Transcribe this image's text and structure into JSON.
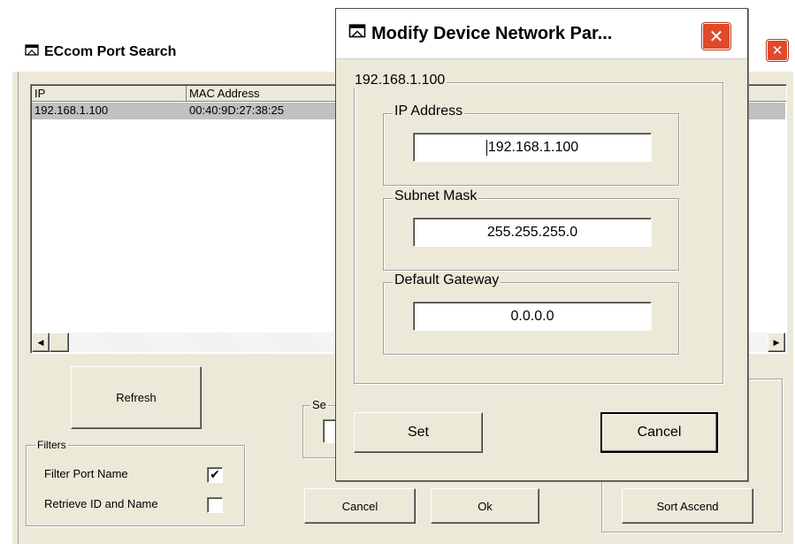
{
  "back_window": {
    "title": "ECcom Port Search",
    "list": {
      "headers": [
        "IP",
        "MAC Address"
      ],
      "rows": [
        {
          "ip": "192.168.1.100",
          "mac": "00:40:9D:27:38:25",
          "selected": true
        }
      ]
    },
    "refresh_label": "Refresh",
    "filters": {
      "group_label": "Filters",
      "filter_port_name": {
        "label": "Filter Port Name",
        "checked": true,
        "mark": "✔"
      },
      "retrieve_id_name": {
        "label": "Retrieve ID and Name",
        "checked": false
      }
    },
    "partial_group_label": "Se",
    "cancel_label": "Cancel",
    "ok_label": "Ok",
    "sort_label": "Sort Ascend",
    "scroll_left_glyph": "◀",
    "scroll_right_glyph": "▶"
  },
  "dialog": {
    "title": "Modify Device Network Par...",
    "group_label": "192.168.1.100",
    "ip": {
      "label": "IP Address",
      "value": "192.168.1.100"
    },
    "subnet": {
      "label": "Subnet Mask",
      "value": "255.255.255.0"
    },
    "gateway": {
      "label": "Default Gateway",
      "value": "0.0.0.0"
    },
    "set_label": "Set",
    "cancel_label": "Cancel"
  },
  "close_glyph": "✕",
  "colors": {
    "window_bg": "#ece9d8",
    "selected_row": "#c0c0c0",
    "close_button": "#e0492a"
  }
}
